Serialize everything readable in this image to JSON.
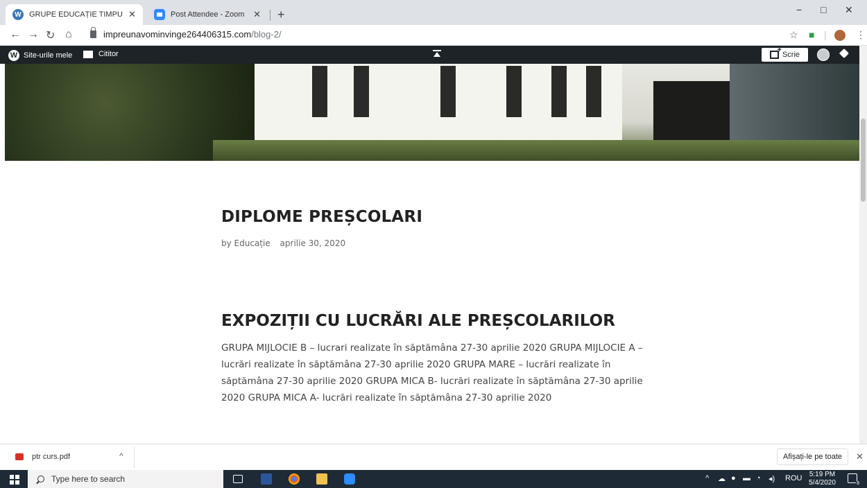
{
  "browser": {
    "tabs": [
      {
        "title": "GRUPE EDUCAȚIE TIMPURIE – Sit",
        "icon": "wordpress-icon",
        "active": true
      },
      {
        "title": "Post Attendee - Zoom",
        "icon": "zoom-icon",
        "active": false
      }
    ],
    "new_tab_symbol": "+",
    "url_host": "impreunavominvinge264406315.com",
    "url_path": "/blog-2/"
  },
  "wp_admin_bar": {
    "my_sites": "Site-urile mele",
    "reader": "Cititor",
    "write": "Scrie"
  },
  "posts": [
    {
      "title": "DIPLOME PREȘCOLARI",
      "author": "by Educație",
      "date": "aprilie 30, 2020"
    },
    {
      "title": "EXPOZIȚII CU LUCRĂRI ALE PREȘCOLARILOR",
      "excerpt": "GRUPA MIJLOCIE B – lucrari realizate în săptămâna 27-30 aprilie 2020 GRUPA MIJLOCIE A – lucrări realizate în săptămâna 27-30 aprilie 2020 GRUPA MARE – lucrări realizate în săptămâna 27-30 aprilie 2020 GRUPA MICA B- lucrări realizate în săptămâna 27-30 aprilie 2020 GRUPA MICA A- lucrări realizate în săptămâna 27-30 aprilie 2020"
    }
  ],
  "download_shelf": {
    "file_name": "ptr curs.pdf",
    "show_all": "Afișați-le pe toate"
  },
  "taskbar": {
    "search_placeholder": "Type here to search",
    "language": "ROU",
    "time": "5:19 PM",
    "date": "5/4/2020",
    "notification_count": "8"
  },
  "colors": {
    "admin_bar": "#1d2327",
    "taskbar": "#1f2a37",
    "tabstrip": "#dee1e6"
  }
}
